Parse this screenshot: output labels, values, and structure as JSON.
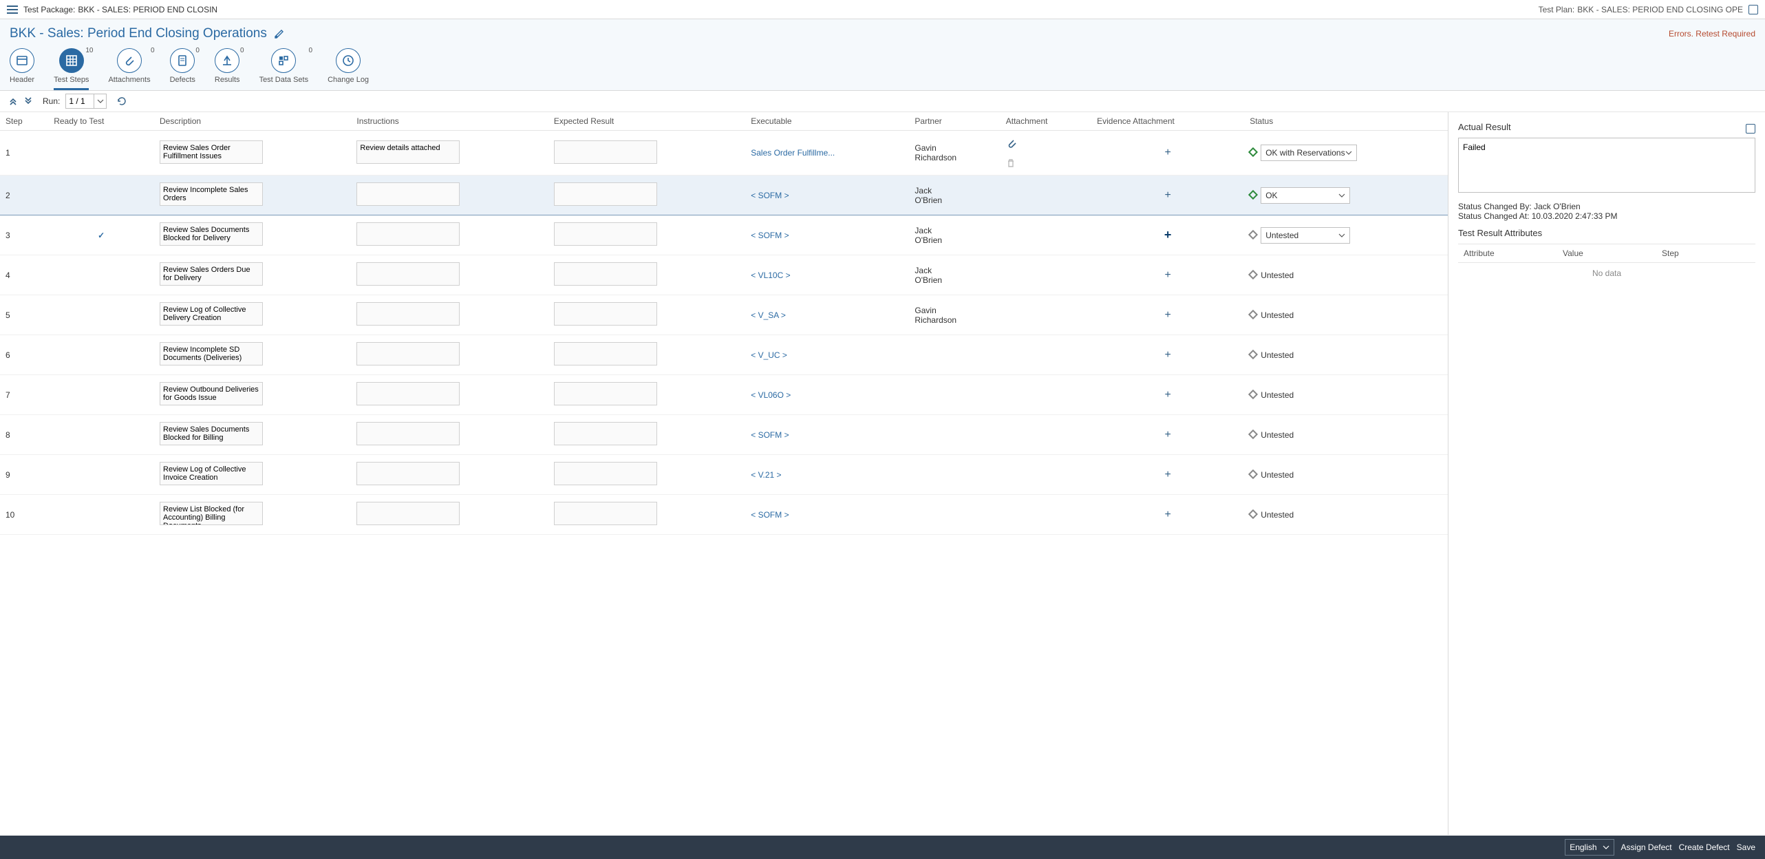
{
  "shell": {
    "package_prefix": "Test Package: ",
    "package": "BKK - SALES: PERIOD END CLOSIN",
    "plan_prefix": "Test Plan: ",
    "plan": "BKK - SALES: PERIOD END CLOSING OPE"
  },
  "title": "BKK - Sales: Period End Closing Operations",
  "error_text": "Errors. Retest Required",
  "tabs": [
    {
      "id": "header",
      "label": "Header",
      "badge": ""
    },
    {
      "id": "teststeps",
      "label": "Test Steps",
      "badge": "10",
      "active": true
    },
    {
      "id": "attachments",
      "label": "Attachments",
      "badge": "0"
    },
    {
      "id": "defects",
      "label": "Defects",
      "badge": "0"
    },
    {
      "id": "results",
      "label": "Results",
      "badge": "0"
    },
    {
      "id": "testdata",
      "label": "Test Data Sets",
      "badge": "0"
    },
    {
      "id": "changelog",
      "label": "Change Log",
      "badge": ""
    }
  ],
  "toolbar": {
    "run_label": "Run:",
    "run_value": "1 / 1"
  },
  "columns": {
    "step": "Step",
    "ready": "Ready to Test",
    "desc": "Description",
    "instr": "Instructions",
    "exp": "Expected Result",
    "exec": "Executable",
    "partner": "Partner",
    "att": "Attachment",
    "evatt": "Evidence Attachment",
    "status": "Status"
  },
  "rows": [
    {
      "step": "1",
      "ready": "",
      "desc": "Review Sales Order Fulfillment Issues",
      "instr": "Review details attached",
      "exp": "",
      "exec": "Sales Order Fulfillme...",
      "partner": "Gavin Richardson",
      "att": "clip",
      "ev": "add",
      "status_dd": true,
      "status_color": "green",
      "status_text": "OK with Reservations"
    },
    {
      "step": "2",
      "ready": "",
      "desc": "Review Incomplete Sales Orders",
      "instr": "",
      "exp": "",
      "exec": "< SOFM >",
      "partner": "Jack O'Brien",
      "att": "",
      "ev": "add",
      "status_dd": true,
      "status_color": "green",
      "status_text": "OK",
      "selected": true
    },
    {
      "step": "3",
      "ready": "check",
      "desc": "Review Sales Documents Blocked for Delivery",
      "instr": "",
      "exp": "",
      "exec": "< SOFM >",
      "partner": "Jack O'Brien",
      "att": "",
      "ev": "addbold",
      "status_dd": true,
      "status_color": "grey",
      "status_text": "Untested"
    },
    {
      "step": "4",
      "ready": "",
      "desc": "Review Sales Orders Due for Delivery",
      "instr": "",
      "exp": "",
      "exec": "< VL10C >",
      "partner": "Jack O'Brien",
      "att": "",
      "ev": "add",
      "status_dd": false,
      "status_color": "grey",
      "status_text": "Untested"
    },
    {
      "step": "5",
      "ready": "",
      "desc": "Review Log of Collective Delivery Creation",
      "instr": "",
      "exp": "",
      "exec": "< V_SA >",
      "partner": "Gavin Richardson",
      "att": "",
      "ev": "add",
      "status_dd": false,
      "status_color": "grey",
      "status_text": "Untested"
    },
    {
      "step": "6",
      "ready": "",
      "desc": "Review Incomplete SD Documents (Deliveries)",
      "instr": "",
      "exp": "",
      "exec": "< V_UC >",
      "partner": "",
      "att": "",
      "ev": "add",
      "status_dd": false,
      "status_color": "grey",
      "status_text": "Untested"
    },
    {
      "step": "7",
      "ready": "",
      "desc": "Review Outbound Deliveries for Goods Issue",
      "instr": "",
      "exp": "",
      "exec": "< VL06O >",
      "partner": "",
      "att": "",
      "ev": "add",
      "status_dd": false,
      "status_color": "grey",
      "status_text": "Untested"
    },
    {
      "step": "8",
      "ready": "",
      "desc": "Review Sales Documents Blocked for Billing",
      "instr": "",
      "exp": "",
      "exec": "< SOFM >",
      "partner": "",
      "att": "",
      "ev": "add",
      "status_dd": false,
      "status_color": "grey",
      "status_text": "Untested"
    },
    {
      "step": "9",
      "ready": "",
      "desc": "Review Log of Collective Invoice Creation",
      "instr": "",
      "exp": "",
      "exec": "< V.21 >",
      "partner": "",
      "att": "",
      "ev": "add",
      "status_dd": false,
      "status_color": "grey",
      "status_text": "Untested"
    },
    {
      "step": "10",
      "ready": "",
      "desc": "Review List Blocked (for Accounting) Billing Documents",
      "instr": "",
      "exp": "",
      "exec": "< SOFM >",
      "partner": "",
      "att": "",
      "ev": "add",
      "status_dd": false,
      "status_color": "grey",
      "status_text": "Untested"
    }
  ],
  "side": {
    "ar_title": "Actual Result",
    "ar_value": "Failed",
    "changed_by_label": "Status Changed By: ",
    "changed_by": "Jack O'Brien",
    "changed_at_label": "Status Changed At: ",
    "changed_at": "10.03.2020 2:47:33 PM",
    "attr_title": "Test Result Attributes",
    "attr_cols": {
      "attr": "Attribute",
      "val": "Value",
      "step": "Step"
    },
    "nodata": "No data"
  },
  "footer": {
    "lang": "English",
    "assign": "Assign Defect",
    "create": "Create Defect",
    "save": "Save"
  }
}
